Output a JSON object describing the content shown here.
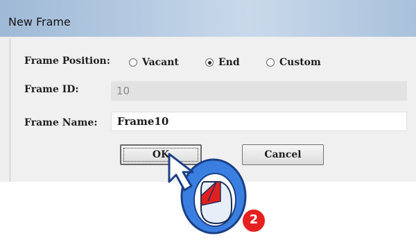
{
  "window": {
    "title": "New Frame"
  },
  "frame_position": {
    "label": "Frame Position:",
    "options": [
      {
        "label": "Vacant",
        "checked": false
      },
      {
        "label": "End",
        "checked": true
      },
      {
        "label": "Custom",
        "checked": false
      }
    ]
  },
  "frame_id": {
    "label": "Frame ID:",
    "value": "10"
  },
  "frame_name": {
    "label": "Frame Name:",
    "value": "Frame10"
  },
  "buttons": {
    "ok": "OK",
    "cancel": "Cancel"
  },
  "annotation": {
    "step_number": "2",
    "accent": "#3a7fe0",
    "badge_color": "#e62020"
  }
}
